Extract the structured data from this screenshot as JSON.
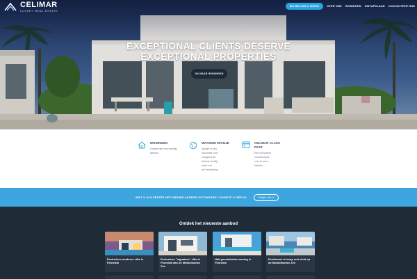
{
  "brand": {
    "name": "CELIMAR",
    "tagline": "LUXURY REAL ESTATE",
    "accent_color": "#2aa5e0",
    "dark_color": "#1f2b37"
  },
  "nav": {
    "cta_label": "WIJ BELLEN U TERUG",
    "items": [
      "OVER ONS",
      "WONINGEN",
      "INSTAPKLAAR",
      "CONTACTEER ONS"
    ]
  },
  "hero": {
    "title_line1": "EXCEPTIONAL CLIENTS DESERVE",
    "title_line2": "EXCEPTIONAL PROPERTIES",
    "button_label": "GA NAAR WONINGEN"
  },
  "features": [
    {
      "icon": "home-icon",
      "title": "WONINGEN",
      "desc": [
        "Ontdek hier ons volledig",
        "aanbod"
      ]
    },
    {
      "icon": "globe-icon",
      "title": "WAAROM SPANJE",
      "desc": [
        "Spanje is een",
        "toplocatie voor",
        "vastgoed als",
        "tweede verblijf",
        "maar ook",
        "als investering"
      ]
    },
    {
      "icon": "card-icon",
      "title": "CELIMAR CLASS PASS",
      "desc": [
        "Een exclusieve",
        "voordelenpas",
        "voor al onze",
        "klanten"
      ]
    }
  ],
  "banner": {
    "text": "WILT U ALS EERSTE HET NIEUWE AANBOD ONTVANGEN? SCHRIJF U HIER IN",
    "button_label": "Schrijf u hier in"
  },
  "listings": {
    "title": "Ontdek het nieuwste aanbod",
    "cards": [
      {
        "title": "Exclusieve moderne villa in Finestrat"
      },
      {
        "title": "Exclusieve \"signature\" villa in Finestrat aan de Middellandse Zee"
      },
      {
        "title": "Half geschakelde woning in Finestrat"
      },
      {
        "title": "Penthouse te koop met zicht op de Middellandse Zee"
      }
    ]
  }
}
